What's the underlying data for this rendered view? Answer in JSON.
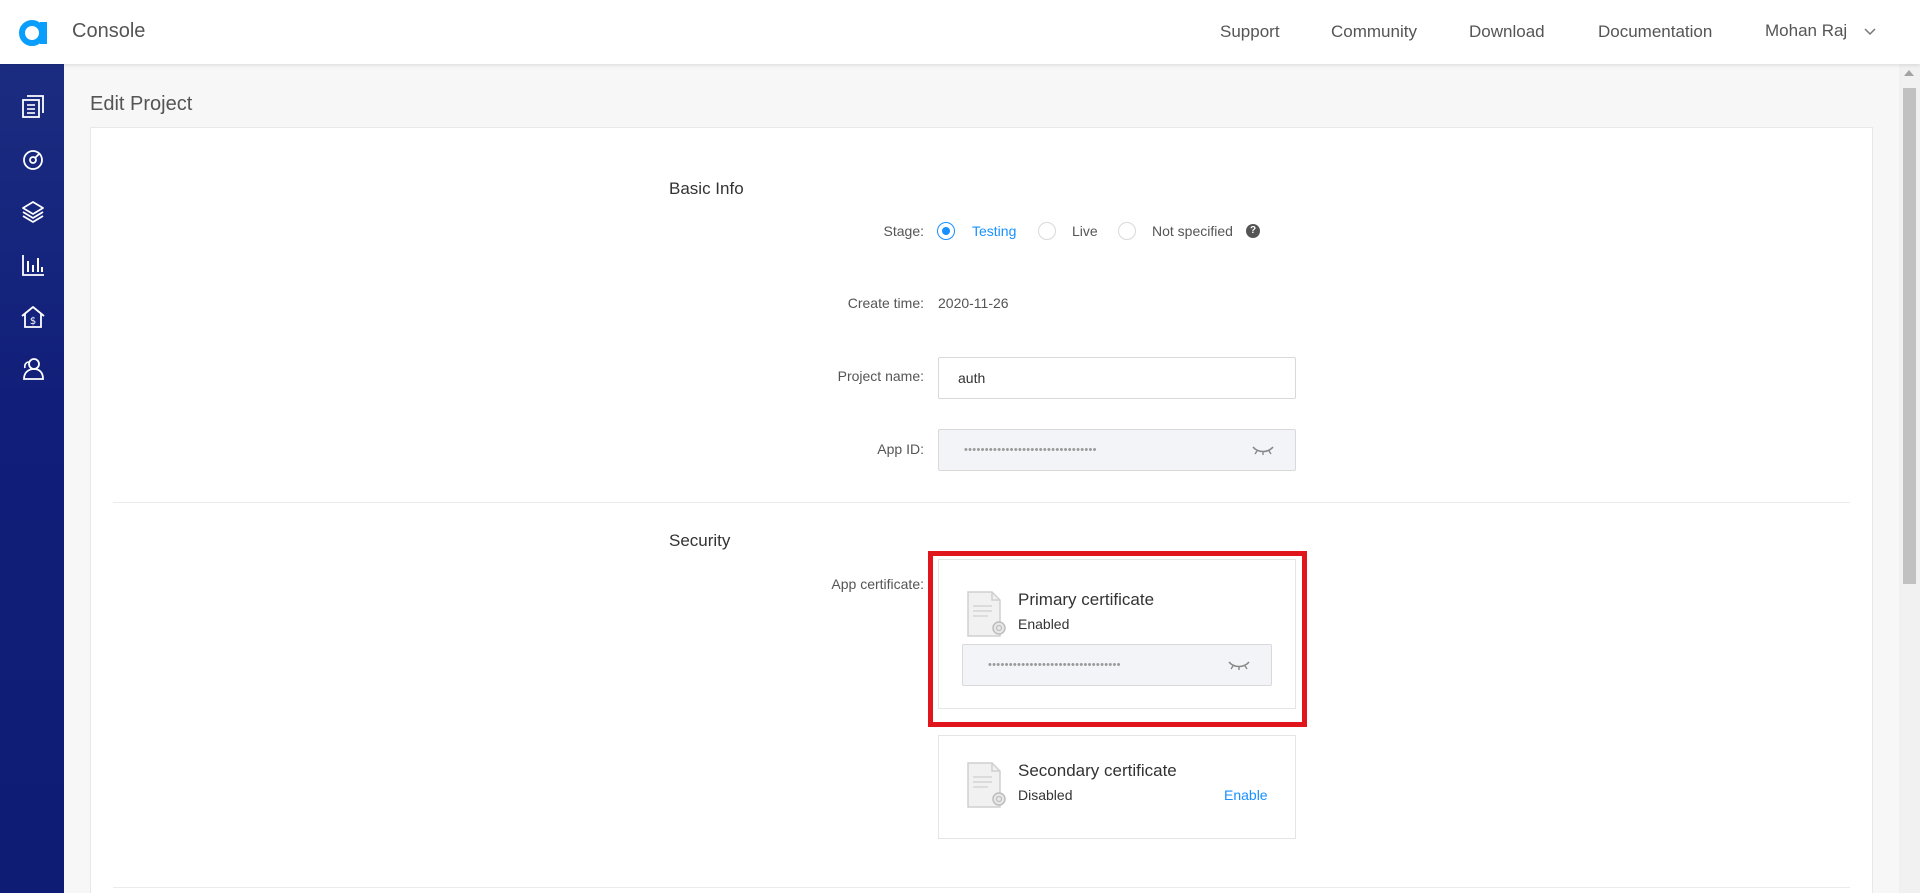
{
  "header": {
    "app_title": "Console",
    "nav": [
      "Support",
      "Community",
      "Download",
      "Documentation"
    ],
    "user_name": "Mohan Raj"
  },
  "sidebar": {
    "icons": [
      "projects-icon",
      "usage-icon",
      "layers-icon",
      "analytics-icon",
      "billing-icon",
      "members-icon"
    ]
  },
  "page": {
    "title": "Edit Project"
  },
  "basic_info": {
    "section_title": "Basic Info",
    "stage_label": "Stage:",
    "stage_options": [
      "Testing",
      "Live",
      "Not specified"
    ],
    "stage_selected": "Testing",
    "help_glyph": "?",
    "create_time_label": "Create time:",
    "create_time_value": "2020-11-26",
    "project_name_label": "Project name:",
    "project_name_value": "auth",
    "app_id_label": "App ID:",
    "app_id_masked": "••••••••••••••••••••••••••••••••"
  },
  "security": {
    "section_title": "Security",
    "app_certificate_label": "App certificate:",
    "primary": {
      "title": "Primary certificate",
      "status": "Enabled",
      "masked": "••••••••••••••••••••••••••••••••"
    },
    "secondary": {
      "title": "Secondary certificate",
      "status": "Disabled",
      "action": "Enable"
    }
  },
  "colors": {
    "accent": "#1890ff",
    "sidebar": "#111f7a",
    "highlight": "#e1151c"
  }
}
